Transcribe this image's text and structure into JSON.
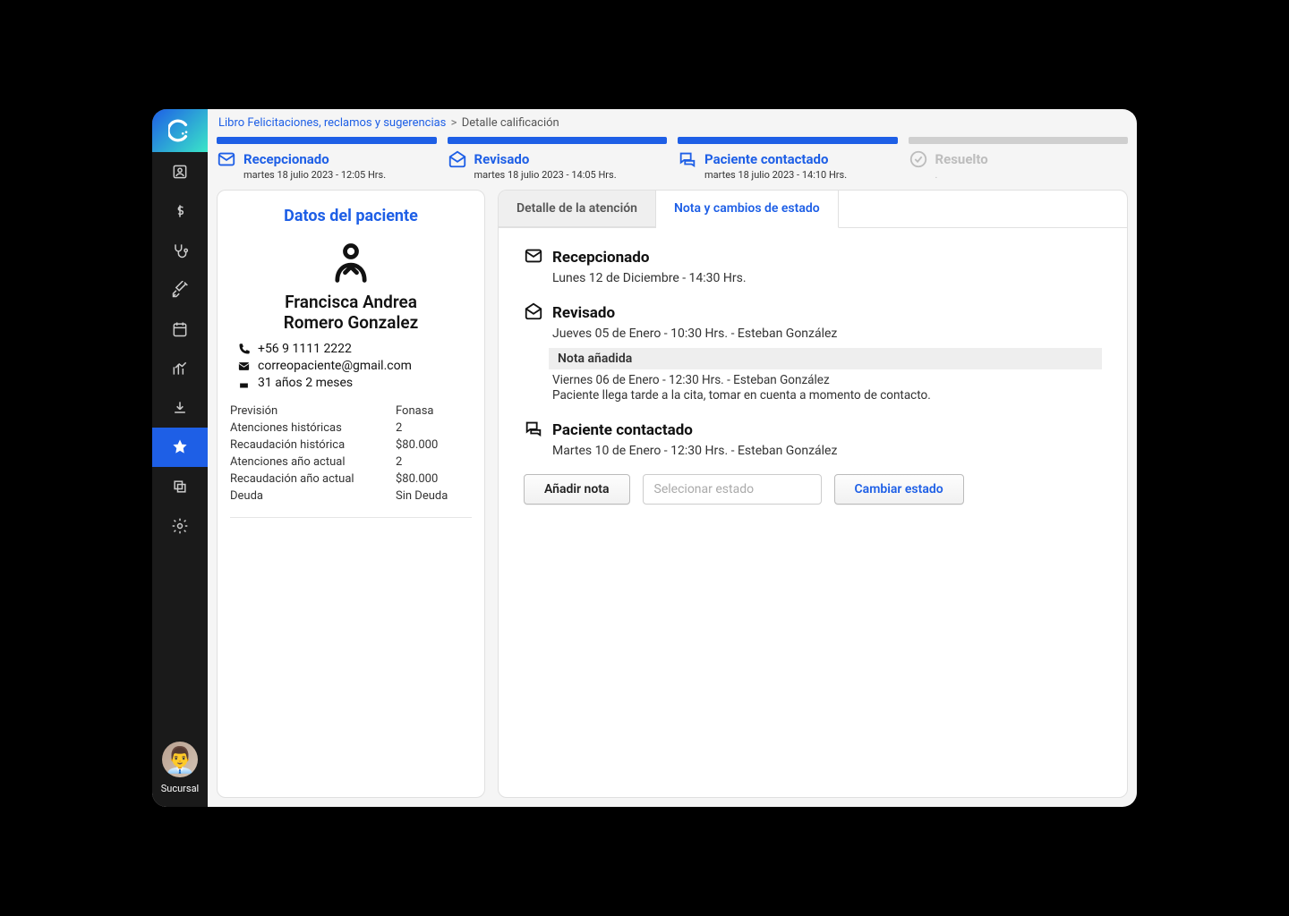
{
  "breadcrumb": {
    "link": "Libro Felicitaciones, reclamos y sugerencias",
    "current": "Detalle calificación"
  },
  "progress": [
    {
      "title": "Recepcionado",
      "sub": "martes 18 julio 2023 - 12:05 Hrs.",
      "active": true,
      "icon": "mail-closed"
    },
    {
      "title": "Revisado",
      "sub": "martes 18 julio 2023 - 14:05 Hrs.",
      "active": true,
      "icon": "mail-open"
    },
    {
      "title": "Paciente contactado",
      "sub": "martes 18 julio 2023 - 14:10 Hrs.",
      "active": true,
      "icon": "chat"
    },
    {
      "title": "Resuelto",
      "sub": ".",
      "active": false,
      "icon": "check-circle"
    }
  ],
  "patient": {
    "card_title": "Datos del paciente",
    "name_line1": "Francisca Andrea",
    "name_line2": "Romero Gonzalez",
    "phone": "+56 9 1111 2222",
    "email": "correopaciente@gmail.com",
    "age": "31 años 2 meses",
    "kv": [
      {
        "k": "Previsión",
        "v": "Fonasa"
      },
      {
        "k": "Atenciones históricas",
        "v": "2"
      },
      {
        "k": "Recaudación histórica",
        "v": "$80.000"
      },
      {
        "k": "Atenciones año actual",
        "v": "2"
      },
      {
        "k": "Recaudación año actual",
        "v": "$80.000"
      },
      {
        "k": "Deuda",
        "v": "Sin Deuda"
      }
    ]
  },
  "tabs": {
    "detalle": "Detalle de la atención",
    "nota": "Nota y cambios de estado"
  },
  "timeline": {
    "recepcionado": {
      "title": "Recepcionado",
      "sub": "Lunes 12 de Diciembre - 14:30 Hrs."
    },
    "revisado": {
      "title": "Revisado",
      "sub": "Jueves 05 de Enero - 10:30 Hrs. - Esteban González",
      "note_title": "Nota añadida",
      "note_line1": "Viernes 06 de Enero - 12:30 Hrs. - Esteban González",
      "note_line2": "Paciente llega tarde a la cita, tomar en cuenta a momento de contacto."
    },
    "contactado": {
      "title": "Paciente contactado",
      "sub": "Martes 10 de Enero - 12:30 Hrs. - Esteban González"
    }
  },
  "actions": {
    "add_note": "Añadir nota",
    "select_placeholder": "Selecionar estado",
    "change_state": "Cambiar estado"
  },
  "sidebar_footer": "Sucursal"
}
